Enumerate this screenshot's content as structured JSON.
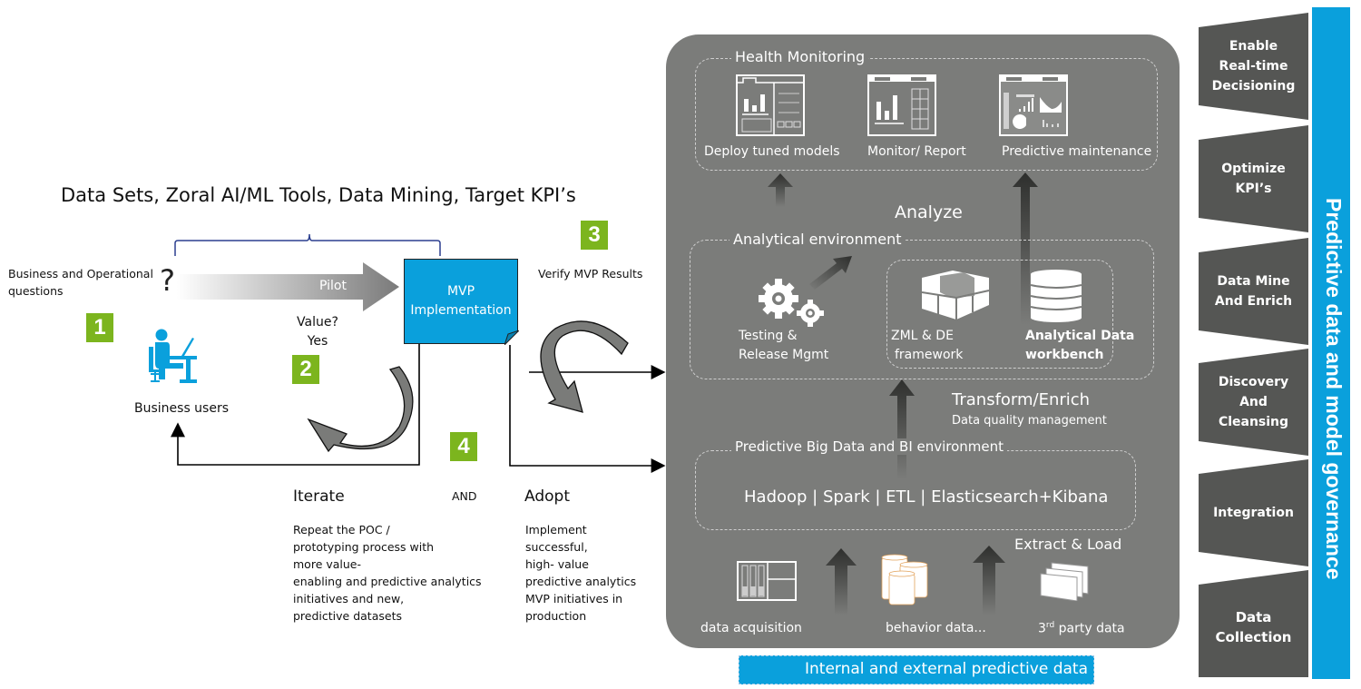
{
  "left": {
    "title": "Data Sets, Zoral AI/ML Tools, Data Mining, Target KPI’s",
    "question_label_line1": "Business and Operational",
    "question_label_line2": "questions",
    "question_mark": "?",
    "pilot_label": "Pilot",
    "mvp_line1": "MVP",
    "mvp_line2": "Implementation",
    "verify_label": "Verify MVP Results",
    "value_line1": "Value?",
    "value_line2": "Yes",
    "business_users": "Business users",
    "badges": [
      "1",
      "2",
      "3",
      "4"
    ],
    "iterate": {
      "heading": "Iterate",
      "lines": [
        "Repeat the POC /",
        "prototyping process with",
        "more value-",
        "enabling and predictive analytics",
        "initiatives  and new,",
        "predictive datasets"
      ]
    },
    "and_label": "AND",
    "adopt": {
      "heading": "Adopt",
      "lines": [
        "Implement",
        "successful,",
        "high- value",
        "predictive analytics",
        "MVP initiatives in",
        "production"
      ]
    }
  },
  "panel": {
    "health": {
      "title": "Health Monitoring",
      "items": [
        "Deploy tuned models",
        "Monitor/ Report",
        "Predictive maintenance"
      ]
    },
    "analyze_label": "Analyze",
    "analytical": {
      "title": "Analytical environment",
      "testing_line1": "Testing &",
      "testing_line2": "Release Mgmt",
      "zml_line1": "ZML & DE",
      "zml_line2": "framework",
      "workbench_line1": "Analytical Data",
      "workbench_line2": "workbench"
    },
    "transform_label": "Transform/Enrich",
    "transform_sub": "Data quality management",
    "bigdata": {
      "title": "Predictive Big Data and BI environment",
      "stack": "Hadoop | Spark | ETL | Elasticsearch+Kibana"
    },
    "extract_label": "Extract & Load",
    "sources": {
      "acquisition": "data acquisition",
      "behavior": "behavior data...",
      "third_prefix": "3",
      "third_sup": "rd",
      "third_rest": " party data"
    },
    "footer": "Internal and  external predictive data"
  },
  "governance": {
    "title": "Predictive data and model governance",
    "steps": [
      {
        "lines": [
          "Enable",
          "Real-time",
          "Decisioning"
        ]
      },
      {
        "lines": [
          "Optimize",
          "KPI’s"
        ]
      },
      {
        "lines": [
          "Data Mine",
          "And Enrich"
        ]
      },
      {
        "lines": [
          "Discovery",
          "And",
          "Cleansing"
        ]
      },
      {
        "lines": [
          "Integration"
        ]
      },
      {
        "lines": [
          "Data",
          "Collection"
        ]
      }
    ]
  },
  "colors": {
    "accent_blue": "#0aa0dc",
    "badge_green": "#7cb51e",
    "panel_gray": "#7b7c7a",
    "chevron_gray": "#555654"
  }
}
